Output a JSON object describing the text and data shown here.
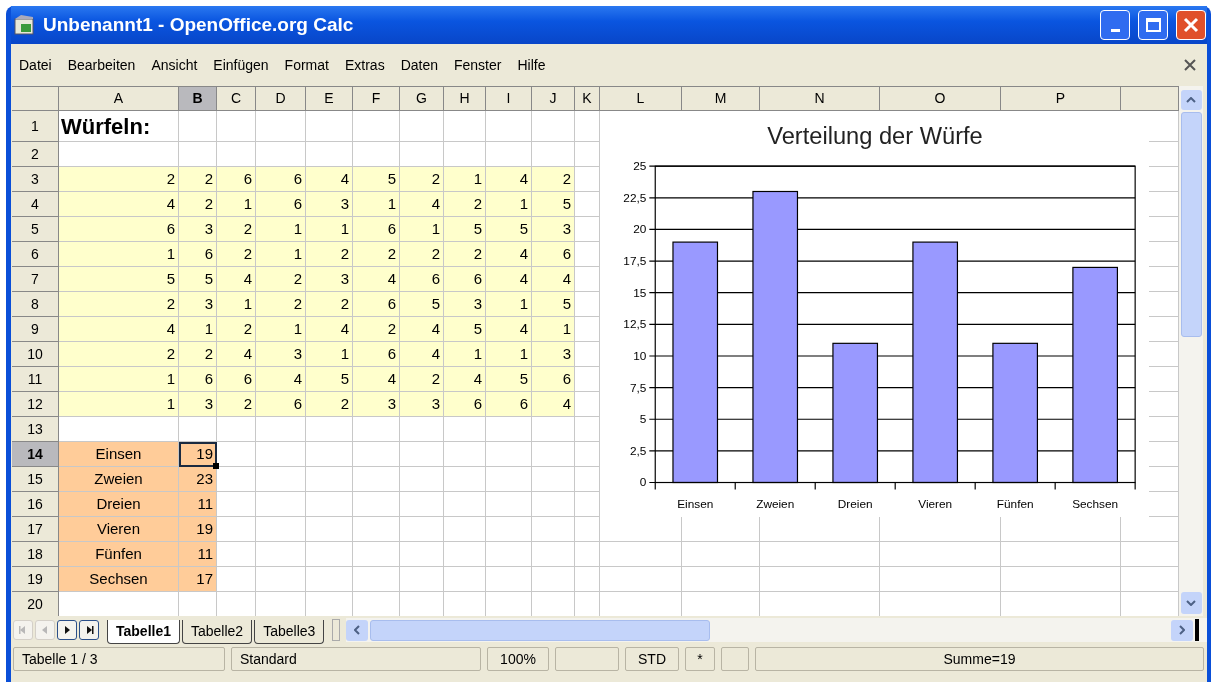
{
  "window": {
    "title": "Unbenannt1 - OpenOffice.org Calc"
  },
  "menu": [
    "Datei",
    "Bearbeiten",
    "Ansicht",
    "Einfügen",
    "Format",
    "Extras",
    "Daten",
    "Fenster",
    "Hilfe"
  ],
  "columns": [
    {
      "label": "A",
      "selected": false
    },
    {
      "label": "B",
      "selected": true
    },
    {
      "label": "C",
      "selected": false
    },
    {
      "label": "D",
      "selected": false
    },
    {
      "label": "E",
      "selected": false
    },
    {
      "label": "F",
      "selected": false
    },
    {
      "label": "G",
      "selected": false
    },
    {
      "label": "H",
      "selected": false
    },
    {
      "label": "I",
      "selected": false
    },
    {
      "label": "J",
      "selected": false
    },
    {
      "label": "K",
      "selected": false
    },
    {
      "label": "L",
      "selected": false
    },
    {
      "label": "M",
      "selected": false
    },
    {
      "label": "N",
      "selected": false
    },
    {
      "label": "O",
      "selected": false
    },
    {
      "label": "P",
      "selected": false
    }
  ],
  "rows": [
    {
      "number": "1",
      "selected": false,
      "kind": "title",
      "cells": [
        "Würfeln:"
      ]
    },
    {
      "number": "2",
      "selected": false,
      "kind": "empty",
      "cells": []
    },
    {
      "number": "3",
      "selected": false,
      "kind": "data",
      "cells": [
        "2",
        "2",
        "6",
        "6",
        "4",
        "5",
        "2",
        "1",
        "4",
        "2"
      ]
    },
    {
      "number": "4",
      "selected": false,
      "kind": "data",
      "cells": [
        "4",
        "2",
        "1",
        "6",
        "3",
        "1",
        "4",
        "2",
        "1",
        "5"
      ]
    },
    {
      "number": "5",
      "selected": false,
      "kind": "data",
      "cells": [
        "6",
        "3",
        "2",
        "1",
        "1",
        "6",
        "1",
        "5",
        "5",
        "3"
      ]
    },
    {
      "number": "6",
      "selected": false,
      "kind": "data",
      "cells": [
        "1",
        "6",
        "2",
        "1",
        "2",
        "2",
        "2",
        "2",
        "4",
        "6"
      ]
    },
    {
      "number": "7",
      "selected": false,
      "kind": "data",
      "cells": [
        "5",
        "5",
        "4",
        "2",
        "3",
        "4",
        "6",
        "6",
        "4",
        "4"
      ]
    },
    {
      "number": "8",
      "selected": false,
      "kind": "data",
      "cells": [
        "2",
        "3",
        "1",
        "2",
        "2",
        "6",
        "5",
        "3",
        "1",
        "5"
      ]
    },
    {
      "number": "9",
      "selected": false,
      "kind": "data",
      "cells": [
        "4",
        "1",
        "2",
        "1",
        "4",
        "2",
        "4",
        "5",
        "4",
        "1"
      ]
    },
    {
      "number": "10",
      "selected": false,
      "kind": "data",
      "cells": [
        "2",
        "2",
        "4",
        "3",
        "1",
        "6",
        "4",
        "1",
        "1",
        "3"
      ]
    },
    {
      "number": "11",
      "selected": false,
      "kind": "data",
      "cells": [
        "1",
        "6",
        "6",
        "4",
        "5",
        "4",
        "2",
        "4",
        "5",
        "6"
      ]
    },
    {
      "number": "12",
      "selected": false,
      "kind": "data",
      "cells": [
        "1",
        "3",
        "2",
        "6",
        "2",
        "3",
        "3",
        "6",
        "6",
        "4"
      ]
    },
    {
      "number": "13",
      "selected": false,
      "kind": "empty",
      "cells": []
    },
    {
      "number": "14",
      "selected": true,
      "kind": "summary",
      "cells": [
        "Einsen",
        "19"
      ]
    },
    {
      "number": "15",
      "selected": false,
      "kind": "summary",
      "cells": [
        "Zweien",
        "23"
      ]
    },
    {
      "number": "16",
      "selected": false,
      "kind": "summary",
      "cells": [
        "Dreien",
        "11"
      ]
    },
    {
      "number": "17",
      "selected": false,
      "kind": "summary",
      "cells": [
        "Vieren",
        "19"
      ]
    },
    {
      "number": "18",
      "selected": false,
      "kind": "summary",
      "cells": [
        "Fünfen",
        "11"
      ]
    },
    {
      "number": "19",
      "selected": false,
      "kind": "summary",
      "cells": [
        "Sechsen",
        "17"
      ]
    },
    {
      "number": "20",
      "selected": false,
      "kind": "empty",
      "cells": []
    }
  ],
  "chart": {
    "chart_data": {
      "type": "bar",
      "grid": true,
      "title": "Verteilung der Würfe",
      "categories": [
        "Einsen",
        "Zweien",
        "Dreien",
        "Vieren",
        "Fünfen",
        "Sechsen"
      ],
      "series": [
        {
          "color": "#9999ff",
          "values": [
            19,
            23,
            11,
            19,
            11,
            17
          ]
        }
      ],
      "ylim": [
        0,
        25
      ],
      "yticks": [
        {
          "value": 0,
          "label": "0"
        },
        {
          "value": 2.5,
          "label": "2,5"
        },
        {
          "value": 5,
          "label": "5"
        },
        {
          "value": 7.5,
          "label": "7,5"
        },
        {
          "value": 10,
          "label": "10"
        },
        {
          "value": 12.5,
          "label": "12,5"
        },
        {
          "value": 15,
          "label": "15"
        },
        {
          "value": 17.5,
          "label": "17,5"
        },
        {
          "value": 20,
          "label": "20"
        },
        {
          "value": 22.5,
          "label": "22,5"
        },
        {
          "value": 25,
          "label": "25"
        }
      ]
    }
  },
  "sheet_nav": [
    {
      "kind": "first",
      "disabled": true
    },
    {
      "kind": "prev",
      "disabled": true
    },
    {
      "kind": "next",
      "disabled": false
    },
    {
      "kind": "last",
      "disabled": false
    }
  ],
  "sheet_tabs": [
    {
      "label": "Tabelle1",
      "selected": true
    },
    {
      "label": "Tabelle2",
      "selected": false
    },
    {
      "label": "Tabelle3",
      "selected": false
    }
  ],
  "status_bar": {
    "sheet": "Tabelle 1 / 3",
    "style": "Standard",
    "zoom": "100%",
    "mode": "STD",
    "modified": "*",
    "sum": "Summe=19"
  }
}
